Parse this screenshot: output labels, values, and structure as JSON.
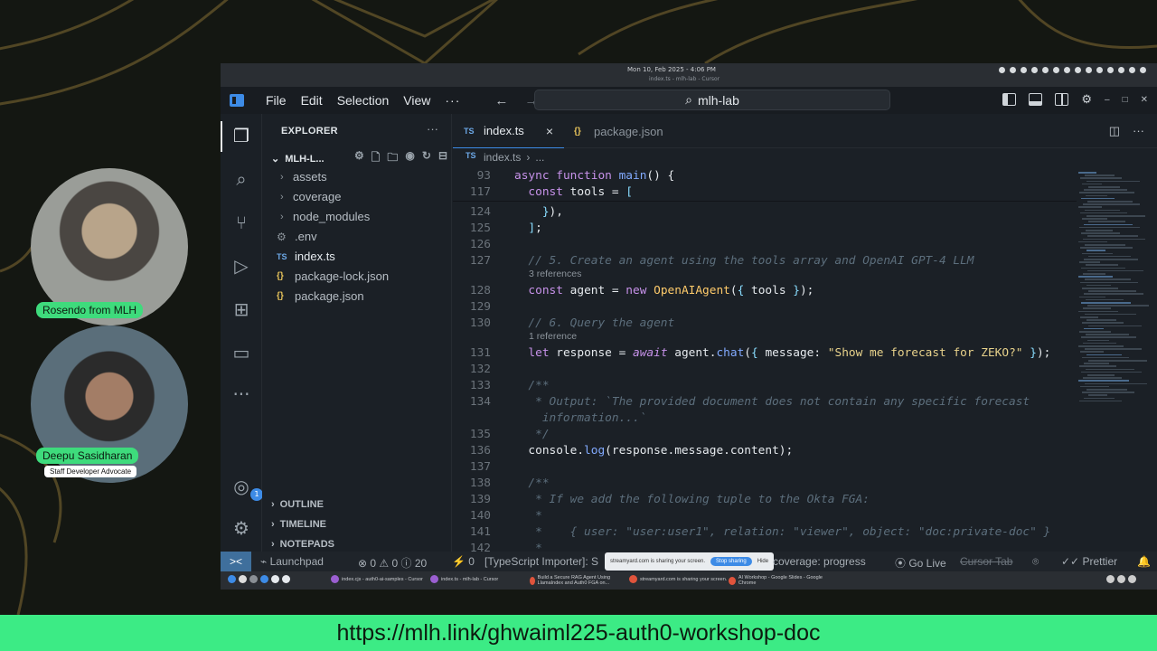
{
  "os": {
    "clock": "Mon 10, Feb 2025 - 4:06 PM",
    "window_subtitle": "index.ts - mlh-lab - Cursor"
  },
  "titlebar": {
    "menus": [
      "File",
      "Edit",
      "Selection",
      "View"
    ],
    "more": "···",
    "search": "mlh-lab"
  },
  "explorer": {
    "title": "EXPLORER",
    "more": "···",
    "folder": "MLH-L...",
    "items": [
      {
        "label": "assets",
        "type": "folder"
      },
      {
        "label": "coverage",
        "type": "folder"
      },
      {
        "label": "node_modules",
        "type": "folder"
      },
      {
        "label": ".env",
        "type": "config"
      },
      {
        "label": "index.ts",
        "type": "ts"
      },
      {
        "label": "package-lock.json",
        "type": "json"
      },
      {
        "label": "package.json",
        "type": "json"
      }
    ],
    "sections": [
      "OUTLINE",
      "TIMELINE",
      "NOTEPADS"
    ]
  },
  "activity": {
    "accounts_badge": "1"
  },
  "editor": {
    "tabs": [
      {
        "icon": "TS",
        "label": "index.ts",
        "close": "×"
      },
      {
        "icon": "{}",
        "label": "package.json"
      }
    ],
    "breadcrumb": [
      "index.ts",
      "..."
    ],
    "lines": [
      {
        "n": "93",
        "segs": [
          [
            "kw",
            "async "
          ],
          [
            "kw",
            "function "
          ],
          [
            "fn",
            "main"
          ],
          [
            "var",
            "() {"
          ]
        ]
      },
      {
        "n": "117",
        "segs": [
          [
            "var",
            "  "
          ],
          [
            "kw",
            "const "
          ],
          [
            "var",
            "tools = "
          ],
          [
            "pun",
            "["
          ]
        ]
      },
      {
        "n": "124",
        "segs": [
          [
            "var",
            "    "
          ],
          [
            "pun",
            "}"
          ],
          [
            "var",
            "),"
          ]
        ]
      },
      {
        "n": "125",
        "segs": [
          [
            "var",
            "  "
          ],
          [
            "pun",
            "]"
          ],
          [
            "var",
            ";"
          ]
        ]
      },
      {
        "n": "126",
        "segs": []
      },
      {
        "n": "127",
        "segs": [
          [
            "cm",
            "  // 5. Create an agent using the tools array and OpenAI GPT-4 LLM"
          ]
        ]
      },
      {
        "n": "128",
        "segs": [
          [
            "var",
            "  "
          ],
          [
            "kw",
            "const "
          ],
          [
            "var",
            "agent = "
          ],
          [
            "kw",
            "new "
          ],
          [
            "cls",
            "OpenAIAgent"
          ],
          [
            "var",
            "("
          ],
          [
            "pun",
            "{ "
          ],
          [
            "var",
            "tools "
          ],
          [
            "pun",
            "}"
          ],
          [
            "var",
            ");"
          ]
        ]
      },
      {
        "n": "129",
        "segs": []
      },
      {
        "n": "130",
        "segs": [
          [
            "cm",
            "  // 6. Query the agent"
          ]
        ]
      },
      {
        "n": "131",
        "segs": [
          [
            "var",
            "  "
          ],
          [
            "kw",
            "let "
          ],
          [
            "var",
            "response = "
          ],
          [
            "aw",
            "await "
          ],
          [
            "var",
            "agent."
          ],
          [
            "fn",
            "chat"
          ],
          [
            "var",
            "("
          ],
          [
            "pun",
            "{ "
          ],
          [
            "var",
            "message: "
          ],
          [
            "str2",
            "\"Show me forecast for ZEKO?\""
          ],
          [
            "pun",
            " }"
          ],
          [
            "var",
            ");"
          ]
        ]
      },
      {
        "n": "132",
        "segs": []
      },
      {
        "n": "133",
        "segs": [
          [
            "cm",
            "  /**"
          ]
        ]
      },
      {
        "n": "134",
        "segs": [
          [
            "cm",
            "   * Output: `The provided document does not contain any specific forecast"
          ]
        ]
      },
      {
        "n": "",
        "segs": [
          [
            "cm",
            "    information...`"
          ]
        ]
      },
      {
        "n": "135",
        "segs": [
          [
            "cm",
            "   */"
          ]
        ]
      },
      {
        "n": "136",
        "segs": [
          [
            "var",
            "  console."
          ],
          [
            "fn",
            "log"
          ],
          [
            "var",
            "(response.message.content);"
          ]
        ]
      },
      {
        "n": "137",
        "segs": []
      },
      {
        "n": "138",
        "segs": [
          [
            "cm",
            "  /**"
          ]
        ]
      },
      {
        "n": "139",
        "segs": [
          [
            "cm",
            "   * If we add the following tuple to the Okta FGA:"
          ]
        ]
      },
      {
        "n": "140",
        "segs": [
          [
            "cm",
            "   *"
          ]
        ]
      },
      {
        "n": "141",
        "segs": [
          [
            "cm",
            "   *    { user: \"user:user1\", relation: \"viewer\", object: \"doc:private-doc\" }"
          ]
        ]
      },
      {
        "n": "142",
        "segs": [
          [
            "cm",
            "   *"
          ]
        ]
      }
    ],
    "references": {
      "r128": "3 references",
      "r131": "1 reference"
    }
  },
  "statusbar": {
    "remote": "><",
    "launchpad": "Launchpad",
    "problems": "⊗ 0 ⚠ 0 ⓘ 20",
    "ports": "⚡ 0",
    "importer": "[TypeScript Importer]: S",
    "share_text": "streamyard.com is sharing your screen.",
    "stop_sharing": "Stop sharing",
    "hide": "Hide",
    "coverage": "coverage: progress",
    "golive": "Go Live",
    "cursor_tab": "Cursor Tab",
    "prettier": "Prettier"
  },
  "taskbar": {
    "items": [
      "index.cjs - auth0-ai-samples - Cursor",
      "index.ts - mlh-lab - Cursor",
      "Build a Secure RAG Agent Using LlamaIndex and Auth0 FGA on...",
      "streamyard.com is sharing your screen.",
      "AI Workshop - Google Slides - Google Chrome"
    ]
  },
  "participants": [
    {
      "name": "Rosendo from MLH"
    },
    {
      "name": "Deepu Sasidharan",
      "role": "Staff Developer Advocate"
    }
  ],
  "banner": {
    "url": "https://mlh.link/ghwaiml225-auth0-workshop-doc"
  },
  "colors": {
    "banner_green": "#3ceb85",
    "accent_blue": "#3d8be6"
  }
}
